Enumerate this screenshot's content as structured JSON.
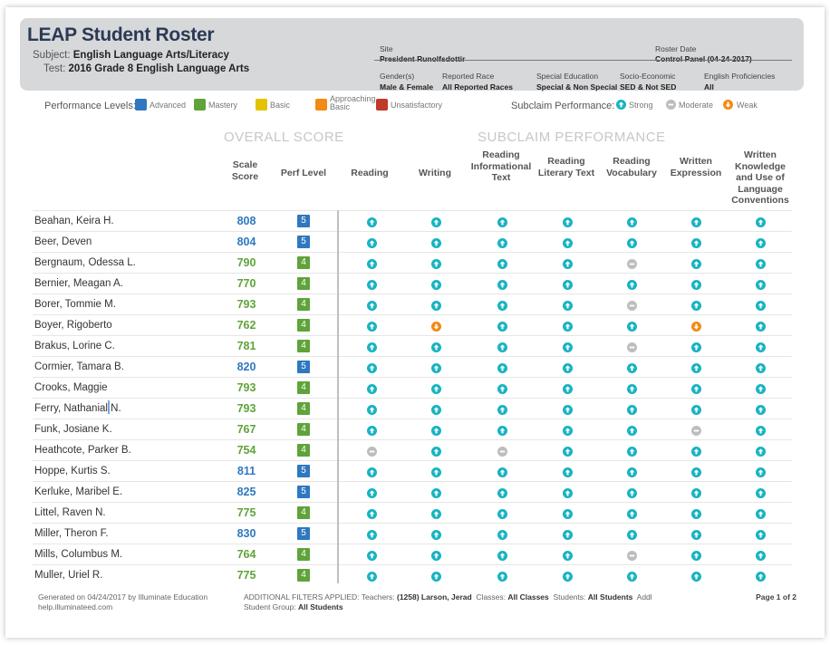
{
  "report": {
    "title": "LEAP Student Roster",
    "subject_label": "Subject:",
    "subject": "English Language Arts/Literacy",
    "test_label": "Test:",
    "test": "2016 Grade 8 English Language Arts"
  },
  "meta": {
    "site_label": "Site",
    "site": "President Runolfsdottir",
    "roster_date_label": "Roster Date",
    "roster_date": "Control Panel (04-24-2017)",
    "gender_label": "Gender(s)",
    "gender": "Male & Female",
    "race_label": "Reported Race",
    "race": "All Reported Races",
    "sped_label": "Special Education",
    "sped": "Special & Non Special",
    "ses_label": "Socio-Economic",
    "ses": "SED & Not SED",
    "ep_label": "English Proficiencies",
    "ep": "All"
  },
  "legend": {
    "perf_title": "Performance Levels:",
    "levels": [
      {
        "label": "Advanced",
        "color": "#2f78c0"
      },
      {
        "label": "Mastery",
        "color": "#5fa33a"
      },
      {
        "label": "Basic",
        "color": "#e3c200"
      },
      {
        "label": "Approaching Basic",
        "color": "#f28a13"
      },
      {
        "label": "Unsatisfactory",
        "color": "#c0392b"
      }
    ],
    "sub_title": "Subclaim Performance:",
    "sub": [
      {
        "label": "Strong",
        "icon": "strong-up-arrow-icon"
      },
      {
        "label": "Moderate",
        "icon": "moderate-minus-icon"
      },
      {
        "label": "Weak",
        "icon": "weak-down-arrow-icon"
      }
    ]
  },
  "sections": {
    "overall": "OVERALL SCORE",
    "subclaim": "SUBCLAIM PERFORMANCE"
  },
  "columns": {
    "scale": "Scale Score",
    "perf": "Perf Level",
    "subclaims": [
      "Reading",
      "Writing",
      "Reading Informational Text",
      "Reading Literary Text",
      "Reading Vocabulary",
      "Written Expression",
      "Written Knowledge and Use of Language Conventions"
    ]
  },
  "colors": {
    "advanced": "#2f78c0",
    "mastery": "#5fa33a",
    "strong": "#17b3c2",
    "moderate": "#bdbdbd",
    "weak": "#f28a13"
  },
  "students": [
    {
      "name": "Beahan, Keira H.",
      "score": "808",
      "level": "5",
      "sub": [
        "S",
        "S",
        "S",
        "S",
        "S",
        "S",
        "S"
      ]
    },
    {
      "name": "Beer, Deven",
      "score": "804",
      "level": "5",
      "sub": [
        "S",
        "S",
        "S",
        "S",
        "S",
        "S",
        "S"
      ]
    },
    {
      "name": "Bergnaum, Odessa L.",
      "score": "790",
      "level": "4",
      "sub": [
        "S",
        "S",
        "S",
        "S",
        "M",
        "S",
        "S"
      ]
    },
    {
      "name": "Bernier, Meagan A.",
      "score": "770",
      "level": "4",
      "sub": [
        "S",
        "S",
        "S",
        "S",
        "S",
        "S",
        "S"
      ]
    },
    {
      "name": "Borer, Tommie M.",
      "score": "793",
      "level": "4",
      "sub": [
        "S",
        "S",
        "S",
        "S",
        "M",
        "S",
        "S"
      ]
    },
    {
      "name": "Boyer, Rigoberto",
      "score": "762",
      "level": "4",
      "sub": [
        "S",
        "W",
        "S",
        "S",
        "S",
        "W",
        "S"
      ]
    },
    {
      "name": "Brakus, Lorine C.",
      "score": "781",
      "level": "4",
      "sub": [
        "S",
        "S",
        "S",
        "S",
        "M",
        "S",
        "S"
      ]
    },
    {
      "name": "Cormier, Tamara B.",
      "score": "820",
      "level": "5",
      "sub": [
        "S",
        "S",
        "S",
        "S",
        "S",
        "S",
        "S"
      ]
    },
    {
      "name": "Crooks, Maggie",
      "score": "793",
      "level": "4",
      "sub": [
        "S",
        "S",
        "S",
        "S",
        "S",
        "S",
        "S"
      ]
    },
    {
      "name": "Ferry, Nathanial N.",
      "score": "793",
      "level": "4",
      "sub": [
        "S",
        "S",
        "S",
        "S",
        "S",
        "S",
        "S"
      ]
    },
    {
      "name": "Funk, Josiane K.",
      "score": "767",
      "level": "4",
      "sub": [
        "S",
        "S",
        "S",
        "S",
        "S",
        "M",
        "S"
      ]
    },
    {
      "name": "Heathcote, Parker B.",
      "score": "754",
      "level": "4",
      "sub": [
        "M",
        "S",
        "M",
        "S",
        "S",
        "S",
        "S"
      ]
    },
    {
      "name": "Hoppe, Kurtis S.",
      "score": "811",
      "level": "5",
      "sub": [
        "S",
        "S",
        "S",
        "S",
        "S",
        "S",
        "S"
      ]
    },
    {
      "name": "Kerluke, Maribel E.",
      "score": "825",
      "level": "5",
      "sub": [
        "S",
        "S",
        "S",
        "S",
        "S",
        "S",
        "S"
      ]
    },
    {
      "name": "Littel, Raven N.",
      "score": "775",
      "level": "4",
      "sub": [
        "S",
        "S",
        "S",
        "S",
        "S",
        "S",
        "S"
      ]
    },
    {
      "name": "Miller, Theron F.",
      "score": "830",
      "level": "5",
      "sub": [
        "S",
        "S",
        "S",
        "S",
        "S",
        "S",
        "S"
      ]
    },
    {
      "name": "Mills, Columbus M.",
      "score": "764",
      "level": "4",
      "sub": [
        "S",
        "S",
        "S",
        "S",
        "M",
        "S",
        "S"
      ]
    },
    {
      "name": "Muller, Uriel R.",
      "score": "775",
      "level": "4",
      "sub": [
        "S",
        "S",
        "S",
        "S",
        "S",
        "S",
        "S"
      ]
    }
  ],
  "footer": {
    "generated": "Generated on 04/24/2017 by Illuminate Education",
    "site": "help.illuminateed.com",
    "filters_label": "ADDITIONAL FILTERS APPLIED:",
    "teachers_label": "Teachers:",
    "teachers": "(1258) Larson, Jerad",
    "classes_label": "Classes:",
    "classes": "All Classes",
    "students_label": "Students:",
    "students": "All Students",
    "addl_label": "Addl Student Group:",
    "addl": "All Students",
    "page": "Page 1 of 2"
  }
}
